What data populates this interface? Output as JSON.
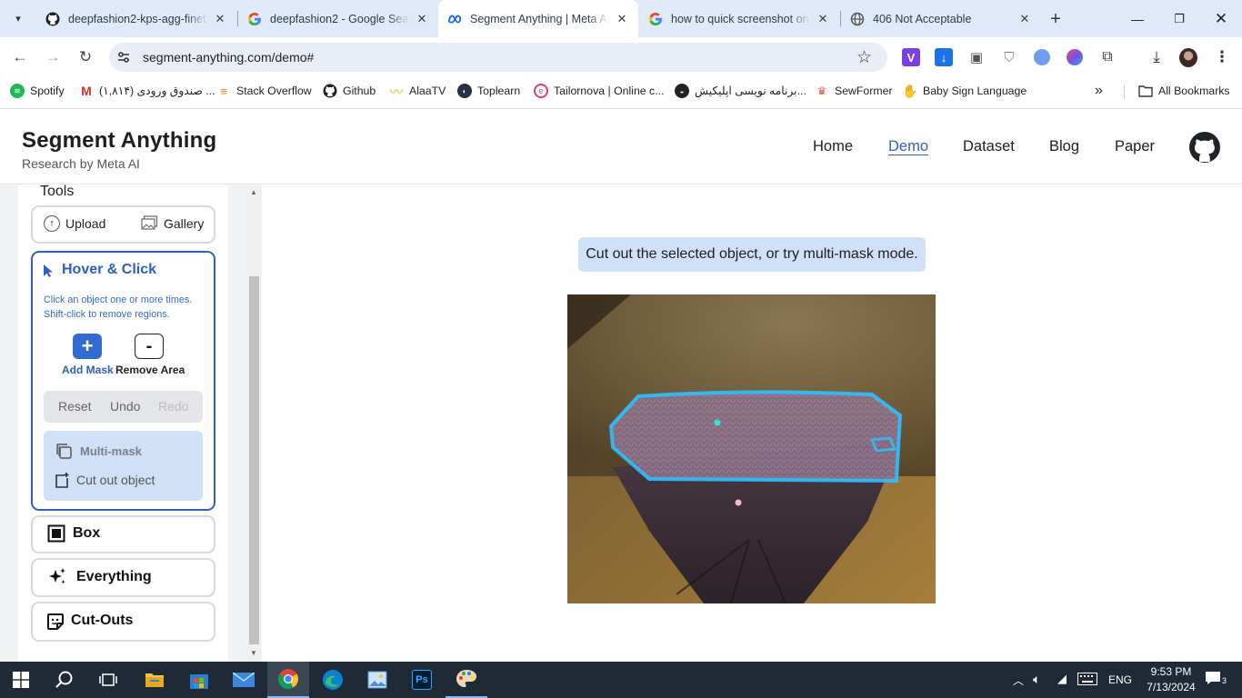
{
  "browser": {
    "tabs": [
      {
        "title": "deepfashion2-kps-agg-finetune",
        "icon": "github-icon",
        "active": false
      },
      {
        "title": "deepfashion2 - Google Search",
        "icon": "google-icon",
        "active": false
      },
      {
        "title": "Segment Anything | Meta AI",
        "icon": "meta-icon",
        "active": true
      },
      {
        "title": "how to quick screenshot on",
        "icon": "google-icon",
        "active": false
      },
      {
        "title": "406 Not Acceptable",
        "icon": "globe-icon",
        "active": false
      }
    ],
    "url": "segment-anything.com/demo#",
    "bookmarks": [
      {
        "label": "Spotify",
        "icon": "spotify-icon",
        "color": "#1db954"
      },
      {
        "label": "صندوق ورودی (۱,۸۱۴) ...",
        "icon": "gmail-icon",
        "color": "#d93025"
      },
      {
        "label": "Stack Overflow",
        "icon": "stackoverflow-icon",
        "color": "#f48024"
      },
      {
        "label": "Github",
        "icon": "github-icon",
        "color": "#111"
      },
      {
        "label": "AlaaTV",
        "icon": "alaatv-icon",
        "color": "#f2a900"
      },
      {
        "label": "Toplearn",
        "icon": "toplearn-icon",
        "color": "#233142"
      },
      {
        "label": "Tailornova | Online c...",
        "icon": "tailornova-icon",
        "color": "#e03c6e"
      },
      {
        "label": "برنامه نویسی اپلیکیش...",
        "icon": "app-icon",
        "color": "#222"
      },
      {
        "label": "SewFormer",
        "icon": "sewformer-icon",
        "color": "#d9534f"
      },
      {
        "label": "Baby Sign Language",
        "icon": "baby-sign-icon",
        "color": "#7bb22a"
      }
    ],
    "all_bookmarks_label": "All Bookmarks",
    "more_label": "»"
  },
  "site": {
    "name": "Segment Anything",
    "tagline": "Research by Meta AI",
    "nav": [
      "Home",
      "Demo",
      "Dataset",
      "Blog",
      "Paper"
    ],
    "active_nav": "Demo"
  },
  "sidebar": {
    "tools_label": "Tools",
    "upload_label": "Upload",
    "gallery_label": "Gallery",
    "hover_click": {
      "title": "Hover & Click",
      "hint_line1": "Click an object one or more times.",
      "hint_line2": "Shift-click to remove regions.",
      "add_mask_label": "Add Mask",
      "remove_area_label": "Remove Area",
      "reset_label": "Reset",
      "undo_label": "Undo",
      "redo_label": "Redo",
      "multimask_label": "Multi-mask",
      "cutout_label": "Cut out object"
    },
    "box_label": "Box",
    "everything_label": "Everything",
    "cutouts_label": "Cut-Outs"
  },
  "canvas": {
    "message": "Cut out the selected object, or try multi-mask mode."
  },
  "taskbar": {
    "lang": "ENG",
    "time": "9:53 PM",
    "date": "7/13/2024",
    "notifications": "3"
  },
  "colors": {
    "accent": "#2f5ec4",
    "highlight_blue": "#cfe0f7",
    "mask_outline": "#2ec0ff"
  }
}
